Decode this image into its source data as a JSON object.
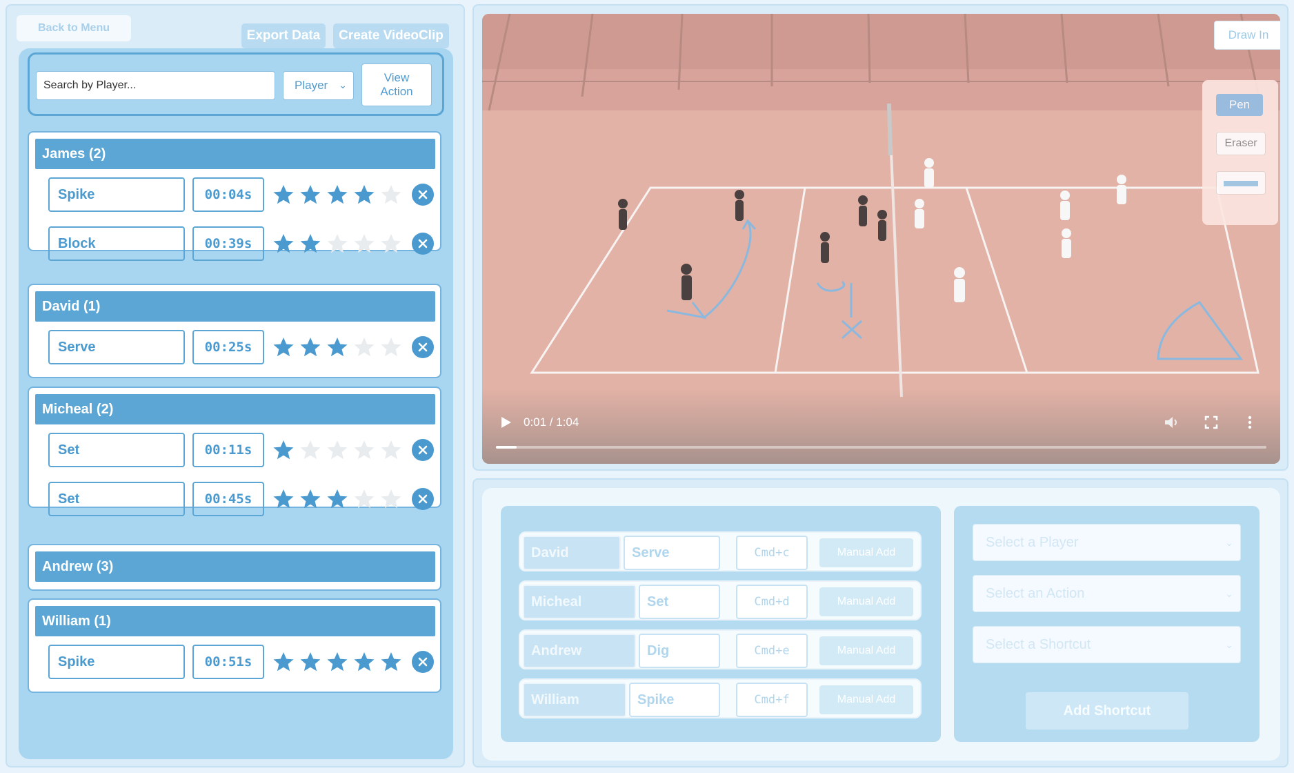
{
  "header": {
    "back_label": "Back to Menu",
    "export_label": "Export Data",
    "create_clip_label": "Create VideoClip"
  },
  "search": {
    "placeholder": "Search by Player...",
    "filter_value": "Player",
    "view_action_line1": "View",
    "view_action_line2": "Action"
  },
  "players": [
    {
      "header": "James (2)",
      "actions": [
        {
          "name": "Spike",
          "time": "00:04s",
          "rating": 4
        },
        {
          "name": "Block",
          "time": "00:39s",
          "rating": 2
        }
      ]
    },
    {
      "header": "David (1)",
      "actions": [
        {
          "name": "Serve",
          "time": "00:25s",
          "rating": 3
        }
      ]
    },
    {
      "header": "Micheal (2)",
      "actions": [
        {
          "name": "Set",
          "time": "00:11s",
          "rating": 1
        },
        {
          "name": "Set",
          "time": "00:45s",
          "rating": 3
        }
      ]
    },
    {
      "header": "Andrew (3)",
      "actions": []
    },
    {
      "header": "William (1)",
      "actions": [
        {
          "name": "Spike",
          "time": "00:51s",
          "rating": 5
        }
      ]
    }
  ],
  "video": {
    "draw_in_label": "Draw In",
    "pen_label": "Pen",
    "eraser_label": "Eraser",
    "time_display": "0:01 / 1:04",
    "progress_fraction": 0.027
  },
  "shortcuts": [
    {
      "player": "David",
      "action": "Serve",
      "key": "Cmd+c",
      "button": "Manual Add"
    },
    {
      "player": "Micheal",
      "action": "Set",
      "key": "Cmd+d",
      "button": "Manual Add"
    },
    {
      "player": "Andrew",
      "action": "Dig",
      "key": "Cmd+e",
      "button": "Manual Add"
    },
    {
      "player": "William",
      "action": "Spike",
      "key": "Cmd+f",
      "button": "Manual Add"
    }
  ],
  "form": {
    "player_placeholder": "Select a Player",
    "action_placeholder": "Select an Action",
    "shortcut_placeholder": "Select a Shortcut",
    "add_label": "Add Shortcut"
  },
  "colors": {
    "accent": "#5ba6d4",
    "star_filled": "#4a9ad0",
    "star_empty": "#e9ecef",
    "court": "#e0aca1"
  }
}
